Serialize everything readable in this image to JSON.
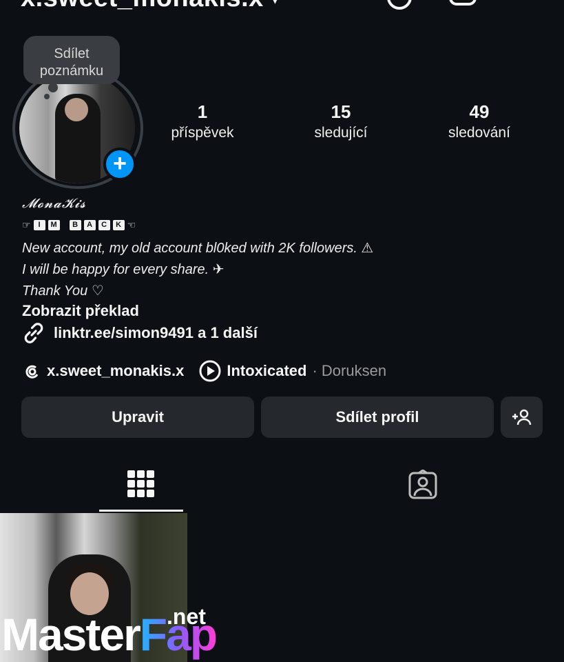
{
  "header": {
    "username": "x.sweet_monakis.x",
    "chevron": "▾"
  },
  "note": {
    "text": "Sdílet poznámku"
  },
  "stats": [
    {
      "value": "1",
      "label": "příspěvek"
    },
    {
      "value": "15",
      "label": "sledující"
    },
    {
      "value": "49",
      "label": "sledování"
    }
  ],
  "bio": {
    "display_name": "𝓜𝓸𝓷𝓪𝓚𝓲𝓼",
    "back_left": "☞",
    "back_tiles": [
      "I",
      "M",
      "B",
      "A",
      "C",
      "K"
    ],
    "back_right": "☜",
    "lines": [
      "New account, my old account bl0ked with 2K followers. ⚠",
      "I will be happy for every share. ✈",
      "Thank You ♡"
    ],
    "translate": "Zobrazit překlad",
    "link": "linktr.ee/simon9491 a 1 další"
  },
  "threads": {
    "handle": "x.sweet_monakis.x",
    "music_title": "Intoxicated",
    "music_artist": "· Doruksen"
  },
  "buttons": {
    "edit": "Upravit",
    "share": "Sdílet profil"
  },
  "watermark": {
    "master": "Master",
    "fap": "Fap",
    "net": ".net"
  },
  "colors": {
    "background": "#0c1014",
    "accent": "#0095f6",
    "button": "#25292e"
  },
  "icons": [
    "threads-logo-icon",
    "add-post-icon",
    "menu-icon",
    "plus-icon",
    "link-icon",
    "threads-icon",
    "play-icon",
    "add-person-icon",
    "grid-icon",
    "tagged-icon"
  ]
}
